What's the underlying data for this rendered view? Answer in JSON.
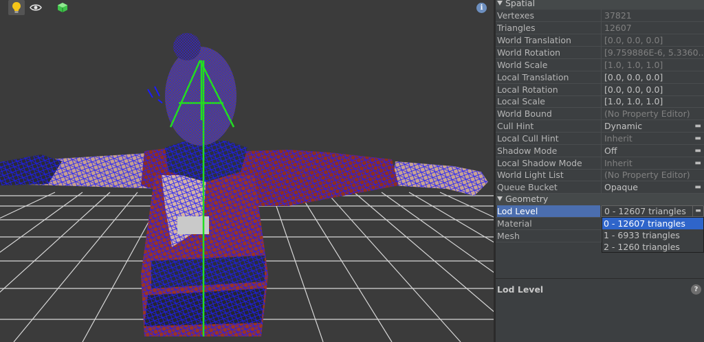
{
  "viewport": {
    "toolbar": {
      "light_icon": "lightbulb-icon",
      "visibility_icon": "eye-icon",
      "geometry_icon": "cube-icon",
      "info_glyph": "i"
    }
  },
  "panel": {
    "spatial": {
      "header": "Spatial",
      "rows": [
        {
          "name": "Vertexes",
          "value": "37821"
        },
        {
          "name": "Triangles",
          "value": "12607"
        },
        {
          "name": "World Translation",
          "value": "[0.0, 0.0, 0.0]"
        },
        {
          "name": "World Rotation",
          "value": "[9.759886E-6, 5.3360..."
        },
        {
          "name": "World Scale",
          "value": "[1.0, 1.0, 1.0]"
        },
        {
          "name": "Local Translation",
          "value": "[0.0, 0.0, 0.0]"
        },
        {
          "name": "Local Rotation",
          "value": "[0.0, 0.0, 0.0]"
        },
        {
          "name": "Local Scale",
          "value": "[1.0, 1.0, 1.0]"
        },
        {
          "name": "World Bound",
          "value": "(No Property Editor)"
        },
        {
          "name": "Cull Hint",
          "value": "Dynamic"
        },
        {
          "name": "Local Cull Hint",
          "value": "Inherit"
        },
        {
          "name": "Shadow Mode",
          "value": "Off"
        },
        {
          "name": "Local Shadow Mode",
          "value": "Inherit"
        },
        {
          "name": "World Light List",
          "value": "(No Property Editor)"
        },
        {
          "name": "Queue Bucket",
          "value": "Opaque"
        }
      ]
    },
    "geometry": {
      "header": "Geometry",
      "rows": [
        {
          "name": "Lod Level",
          "value": "0 - 12607 triangles"
        },
        {
          "name": "Material",
          "value": ""
        },
        {
          "name": "Mesh",
          "value": ""
        }
      ]
    },
    "dropdown": {
      "options": [
        "0 - 12607 triangles",
        "1 - 6933 triangles",
        "2 - 1260 triangles"
      ],
      "selected_index": 0
    },
    "description": {
      "title": "Lod Level",
      "help_glyph": "?"
    }
  },
  "colors": {
    "selection": "#4b6eaf",
    "dropdown_selection": "#2f65ca",
    "wireframe": "#1a1aff",
    "bone": "#22dd22",
    "cloth": "#9a2a1a"
  }
}
